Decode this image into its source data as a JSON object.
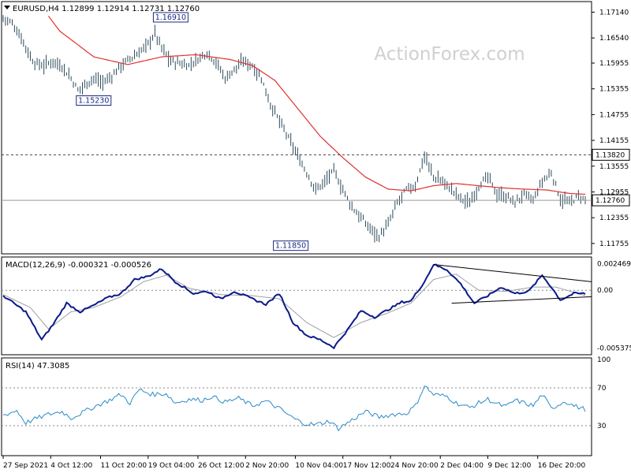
{
  "header": {
    "symbol_caption": "EURUSD,H4  1.12899 1.12914 1.12731 1.12760"
  },
  "watermark": "ActionForex.com",
  "colors": {
    "price_bars": "#2b4a5a",
    "ma_line": "#e03030",
    "macd_line": "#0a1a8a",
    "signal_line": "#a0a0a0",
    "rsi_line": "#2a8ac8",
    "level_line": "#333333"
  },
  "chart_data": [
    {
      "type": "ohlc",
      "series_name": "EURUSD,H4",
      "ohlc_caption": [
        "1.12899",
        "1.12914",
        "1.12731",
        "1.12760"
      ],
      "x_tick_labels": [
        "27 Sep 2021",
        "4 Oct 12:00",
        "11 Oct 20:00",
        "19 Oct 04:00",
        "26 Oct 12:00",
        "2 Nov 20:00",
        "10 Nov 04:00",
        "17 Nov 12:00",
        "24 Nov 20:00",
        "2 Dec 04:00",
        "9 Dec 12:00",
        "16 Dec 20:00"
      ],
      "y_tick_labels": [
        "1.17140",
        "1.16540",
        "1.15955",
        "1.15355",
        "1.14755",
        "1.14155",
        "1.13555",
        "1.12955",
        "1.12355",
        "1.11755"
      ],
      "ylim": [
        1.1155,
        1.1735
      ],
      "current_price_label": "1.12760",
      "current_price": 1.1276,
      "level_label": "1.13820",
      "level": 1.1382,
      "annotations": [
        {
          "label": "1.16910",
          "index": 67
        },
        {
          "label": "1.15230",
          "index": 33
        },
        {
          "label": "1.11850",
          "index": 120
        }
      ],
      "close_path": [
        [
          0,
          1.17
        ],
        [
          4,
          1.1688
        ],
        [
          8,
          1.1655
        ],
        [
          12,
          1.161
        ],
        [
          14,
          1.1595
        ],
        [
          18,
          1.159
        ],
        [
          22,
          1.16
        ],
        [
          26,
          1.1588
        ],
        [
          30,
          1.156
        ],
        [
          33,
          1.1532
        ],
        [
          36,
          1.1545
        ],
        [
          40,
          1.156
        ],
        [
          44,
          1.155
        ],
        [
          48,
          1.1565
        ],
        [
          52,
          1.159
        ],
        [
          56,
          1.1605
        ],
        [
          60,
          1.162
        ],
        [
          64,
          1.164
        ],
        [
          67,
          1.1665
        ],
        [
          70,
          1.163
        ],
        [
          74,
          1.16
        ],
        [
          78,
          1.1595
        ],
        [
          82,
          1.159
        ],
        [
          86,
          1.1605
        ],
        [
          90,
          1.162
        ],
        [
          94,
          1.1598
        ],
        [
          98,
          1.156
        ],
        [
          102,
          1.158
        ],
        [
          106,
          1.16
        ],
        [
          110,
          1.159
        ],
        [
          114,
          1.156
        ],
        [
          118,
          1.15
        ],
        [
          122,
          1.146
        ],
        [
          126,
          1.142
        ],
        [
          130,
          1.138
        ],
        [
          134,
          1.134
        ],
        [
          138,
          1.13
        ],
        [
          142,
          1.132
        ],
        [
          146,
          1.1345
        ],
        [
          150,
          1.13
        ],
        [
          154,
          1.126
        ],
        [
          158,
          1.1235
        ],
        [
          162,
          1.121
        ],
        [
          166,
          1.1192
        ],
        [
          170,
          1.122
        ],
        [
          174,
          1.127
        ],
        [
          178,
          1.13
        ],
        [
          182,
          1.131
        ],
        [
          186,
          1.138
        ],
        [
          190,
          1.133
        ],
        [
          194,
          1.132
        ],
        [
          198,
          1.13
        ],
        [
          202,
          1.128
        ],
        [
          206,
          1.127
        ],
        [
          210,
          1.131
        ],
        [
          214,
          1.133
        ],
        [
          218,
          1.129
        ],
        [
          222,
          1.1285
        ],
        [
          226,
          1.127
        ],
        [
          230,
          1.129
        ],
        [
          234,
          1.1275
        ],
        [
          238,
          1.132
        ],
        [
          242,
          1.134
        ],
        [
          246,
          1.128
        ],
        [
          250,
          1.127
        ],
        [
          254,
          1.1285
        ],
        [
          257,
          1.1276
        ]
      ],
      "bar_count": 258,
      "ma_path": [
        [
          20,
          1.1705
        ],
        [
          25,
          1.167
        ],
        [
          40,
          1.161
        ],
        [
          55,
          1.1592
        ],
        [
          70,
          1.161
        ],
        [
          85,
          1.1615
        ],
        [
          100,
          1.1604
        ],
        [
          110,
          1.159
        ],
        [
          120,
          1.1555
        ],
        [
          130,
          1.149
        ],
        [
          140,
          1.1425
        ],
        [
          150,
          1.1375
        ],
        [
          160,
          1.133
        ],
        [
          170,
          1.1302
        ],
        [
          180,
          1.1298
        ],
        [
          190,
          1.131
        ],
        [
          200,
          1.1315
        ],
        [
          210,
          1.131
        ],
        [
          220,
          1.1305
        ],
        [
          230,
          1.1302
        ],
        [
          240,
          1.13
        ],
        [
          250,
          1.1292
        ],
        [
          257,
          1.129
        ]
      ]
    },
    {
      "type": "line",
      "label": "MACD(12,26,9) -0.000321 -0.000526",
      "y_tick_labels": [
        "0.002469",
        "0.00",
        "-0.005375"
      ],
      "ylim": [
        -0.00585,
        0.00295
      ],
      "series": [
        {
          "name": "MACD",
          "values": [
            [
              0,
              -0.0005
            ],
            [
              10,
              -0.002
            ],
            [
              17,
              -0.0046
            ],
            [
              22,
              -0.0032
            ],
            [
              28,
              -0.0012
            ],
            [
              34,
              -0.002
            ],
            [
              40,
              -0.0014
            ],
            [
              46,
              -0.0007
            ],
            [
              52,
              -0.0003
            ],
            [
              58,
              0.001
            ],
            [
              64,
              0.0013
            ],
            [
              70,
              0.002
            ],
            [
              76,
              0.0008
            ],
            [
              84,
              -0.0003
            ],
            [
              90,
              -0.0001
            ],
            [
              96,
              -0.0008
            ],
            [
              102,
              -0.0001
            ],
            [
              110,
              -0.0008
            ],
            [
              116,
              -0.0013
            ],
            [
              122,
              -0.0003
            ],
            [
              128,
              -0.003
            ],
            [
              134,
              -0.0042
            ],
            [
              140,
              -0.0046
            ],
            [
              146,
              -0.0053
            ],
            [
              152,
              -0.0037
            ],
            [
              158,
              -0.0019
            ],
            [
              164,
              -0.0025
            ],
            [
              170,
              -0.0018
            ],
            [
              176,
              -0.0011
            ],
            [
              180,
              -0.001
            ],
            [
              186,
              0.0008
            ],
            [
              190,
              0.0024
            ],
            [
              196,
              0.0019
            ],
            [
              202,
              0.0006
            ],
            [
              208,
              -0.0012
            ],
            [
              214,
              -0.0005
            ],
            [
              220,
              0.0003
            ],
            [
              226,
              -0.0003
            ],
            [
              232,
              -0.0001
            ],
            [
              238,
              0.0014
            ],
            [
              242,
              0.0003
            ],
            [
              246,
              -0.0009
            ],
            [
              252,
              -0.0003
            ],
            [
              257,
              -0.0003
            ]
          ]
        },
        {
          "name": "Signal",
          "values": [
            [
              0,
              -0.0004
            ],
            [
              12,
              -0.0016
            ],
            [
              20,
              -0.0036
            ],
            [
              30,
              -0.002
            ],
            [
              40,
              -0.0016
            ],
            [
              52,
              -0.0006
            ],
            [
              62,
              0.0008
            ],
            [
              72,
              0.0014
            ],
            [
              82,
              0.0002
            ],
            [
              96,
              -0.0004
            ],
            [
              110,
              -0.0005
            ],
            [
              122,
              -0.0008
            ],
            [
              134,
              -0.003
            ],
            [
              146,
              -0.0044
            ],
            [
              158,
              -0.003
            ],
            [
              170,
              -0.0021
            ],
            [
              180,
              -0.0012
            ],
            [
              190,
              0.001
            ],
            [
              200,
              0.0015
            ],
            [
              210,
              0.0
            ],
            [
              222,
              -0.0001
            ],
            [
              234,
              0.0003
            ],
            [
              244,
              0.0003
            ],
            [
              257,
              -0.0005
            ]
          ]
        }
      ],
      "trendlines": [
        {
          "from": [
            190,
            0.0024
          ],
          "to": [
            257,
            0.0008
          ]
        },
        {
          "from": [
            198,
            -0.0012
          ],
          "to": [
            257,
            -0.0006
          ]
        }
      ]
    },
    {
      "type": "line",
      "label": "RSI(14) 47.3085",
      "y_tick_labels": [
        "100",
        "70",
        "30"
      ],
      "ylim": [
        0,
        100
      ],
      "levels": [
        70,
        30
      ],
      "series": [
        {
          "name": "RSI",
          "values": [
            [
              0,
              41
            ],
            [
              6,
              46
            ],
            [
              10,
              33
            ],
            [
              14,
              37
            ],
            [
              20,
              42
            ],
            [
              26,
              45
            ],
            [
              30,
              38
            ],
            [
              36,
              45
            ],
            [
              40,
              50
            ],
            [
              46,
              56
            ],
            [
              52,
              63
            ],
            [
              56,
              54
            ],
            [
              60,
              68
            ],
            [
              66,
              63
            ],
            [
              72,
              64
            ],
            [
              76,
              54
            ],
            [
              82,
              58
            ],
            [
              88,
              57
            ],
            [
              92,
              61
            ],
            [
              98,
              55
            ],
            [
              104,
              59
            ],
            [
              110,
              51
            ],
            [
              116,
              56
            ],
            [
              122,
              48
            ],
            [
              128,
              38
            ],
            [
              132,
              33
            ],
            [
              138,
              31
            ],
            [
              144,
              35
            ],
            [
              148,
              27
            ],
            [
              152,
              33
            ],
            [
              156,
              39
            ],
            [
              160,
              45
            ],
            [
              166,
              39
            ],
            [
              172,
              42
            ],
            [
              178,
              43
            ],
            [
              182,
              51
            ],
            [
              186,
              72
            ],
            [
              190,
              63
            ],
            [
              196,
              61
            ],
            [
              200,
              54
            ],
            [
              206,
              49
            ],
            [
              210,
              54
            ],
            [
              214,
              58
            ],
            [
              218,
              53
            ],
            [
              222,
              50
            ],
            [
              226,
              57
            ],
            [
              230,
              54
            ],
            [
              234,
              51
            ],
            [
              238,
              63
            ],
            [
              242,
              48
            ],
            [
              248,
              56
            ],
            [
              252,
              51
            ],
            [
              257,
              47.3
            ]
          ]
        }
      ]
    }
  ]
}
